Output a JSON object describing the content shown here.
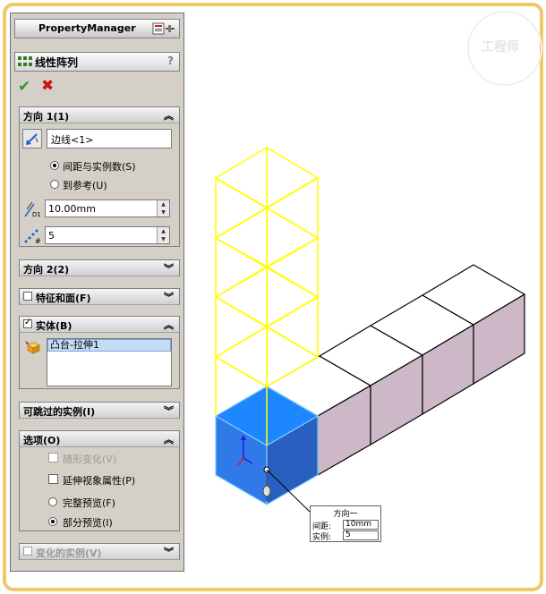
{
  "panel": {
    "title": "PropertyManager",
    "feature_title": "线性阵列",
    "help": "?",
    "ok_icon": "✔",
    "cancel_icon": "✖"
  },
  "dir1": {
    "title": "方向 1(1)",
    "edge": "边线<1>",
    "opt_spacing": "间距与实例数(S)",
    "opt_ref": "到参考(U)",
    "spacing": "10.00mm",
    "count": "5"
  },
  "dir2": {
    "title": "方向 2(2)"
  },
  "features": {
    "title": "特征和面(F)"
  },
  "bodies": {
    "title": "实体(B)",
    "item": "凸台-拉伸1"
  },
  "skip": {
    "title": "可跳过的实例(I)"
  },
  "options": {
    "title": "选项(O)",
    "vary": "随形变化(V)",
    "propagate": "延伸视象属性(P)",
    "full_preview": "完整预览(F)",
    "partial_preview": "部分预览(I)"
  },
  "varied": {
    "title": "变化的实例(V)"
  },
  "callout": {
    "title": "方向一",
    "spacing_label": "间距:",
    "spacing_value": "10mm",
    "count_label": "实例:",
    "count_value": "5"
  },
  "watermark": "工程师",
  "colors": {
    "preview": "#ffff00",
    "selected_face": "#1e86ff",
    "box_side": "#cdb8c7",
    "frame": "#efc86a"
  }
}
